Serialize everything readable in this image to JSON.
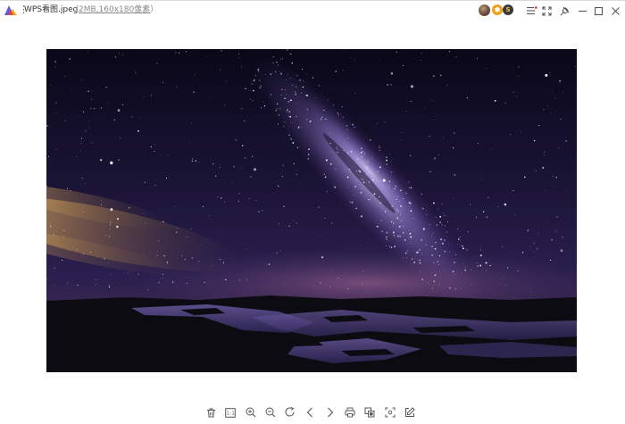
{
  "window": {
    "title": "WPS看图.jpeg",
    "meta_open": "（",
    "meta": "2MB,160x180像素",
    "meta_close": "）",
    "menu_glyph": "⋮",
    "badge_1": "⬢",
    "badge_2": "S"
  },
  "icons": {
    "app_logo": "wps-viewer-logo-icon",
    "avatar": "user-avatar",
    "controls": [
      "list-menu-icon",
      "fullscreen-icon",
      "pin-icon",
      "minimize-icon",
      "maximize-icon",
      "close-icon"
    ]
  },
  "image": {
    "description_kind": "night-sky-milky-way-photo",
    "palette": {
      "sky_top": "#0a0718",
      "sky_mid": "#2a1f4f",
      "milky_way": "#b9a3e6",
      "horizon_glow": "#7a4e8e",
      "orange_glow": "#d9a860",
      "water": "#4a3c78",
      "ground": "#0c0b12"
    }
  },
  "toolbar": {
    "actual_size_label": "1:1",
    "items": [
      "delete-icon",
      "actual-size-icon",
      "zoom-in-icon",
      "zoom-out-icon",
      "rotate-icon",
      "previous-icon",
      "next-icon",
      "print-icon",
      "compare-icon",
      "crop-icon",
      "edit-icon"
    ]
  },
  "colors": {
    "title_text": "#333333",
    "meta_text": "#8a8a8a",
    "icon": "#555555",
    "pin_dot": "#e0463a"
  }
}
